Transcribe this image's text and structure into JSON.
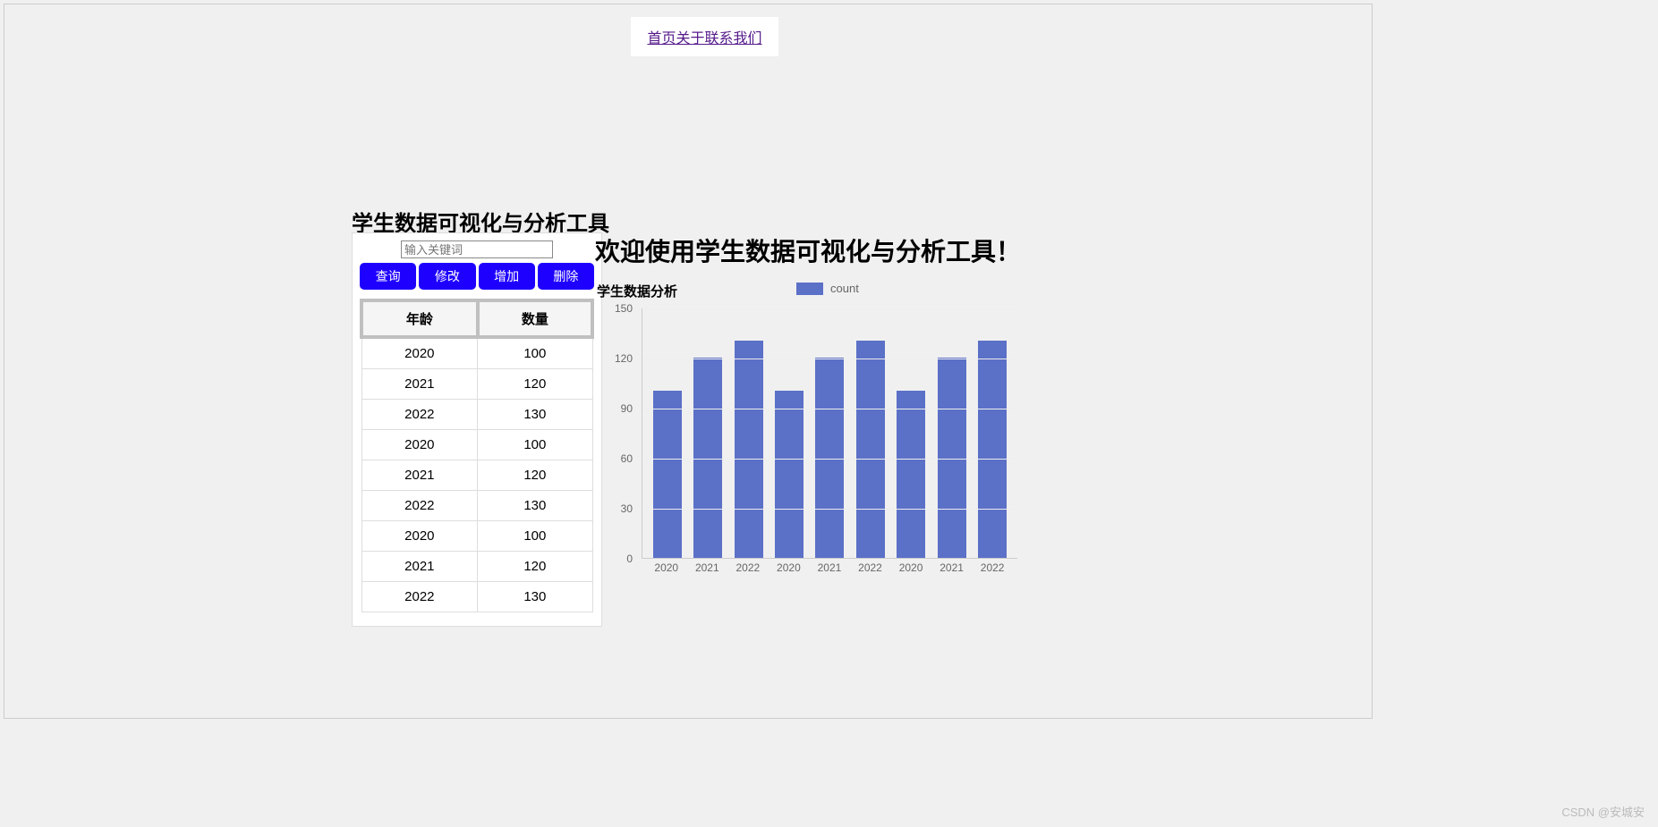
{
  "nav": {
    "links": [
      "首页",
      "关于",
      "联系我们"
    ]
  },
  "page_title": "学生数据可视化与分析工具",
  "search": {
    "placeholder": "输入关键词"
  },
  "buttons": {
    "query": "查询",
    "modify": "修改",
    "add": "增加",
    "delete": "删除"
  },
  "table": {
    "headers": {
      "age": "年龄",
      "count": "数量"
    },
    "rows": [
      {
        "age": "2020",
        "count": "100"
      },
      {
        "age": "2021",
        "count": "120"
      },
      {
        "age": "2022",
        "count": "130"
      },
      {
        "age": "2020",
        "count": "100"
      },
      {
        "age": "2021",
        "count": "120"
      },
      {
        "age": "2022",
        "count": "130"
      },
      {
        "age": "2020",
        "count": "100"
      },
      {
        "age": "2021",
        "count": "120"
      },
      {
        "age": "2022",
        "count": "130"
      }
    ]
  },
  "welcome_text": "欢迎使用学生数据可视化与分析工具！",
  "chart_section_title": "学生数据分析",
  "legend_label": "count",
  "chart_data": {
    "type": "bar",
    "title": "学生数据分析",
    "xlabel": "",
    "ylabel": "",
    "ylim": [
      0,
      150
    ],
    "y_ticks": [
      0,
      30,
      60,
      90,
      120,
      150
    ],
    "categories": [
      "2020",
      "2021",
      "2022",
      "2020",
      "2021",
      "2022",
      "2020",
      "2021",
      "2022"
    ],
    "series": [
      {
        "name": "count",
        "values": [
          100,
          120,
          130,
          100,
          120,
          130,
          100,
          120,
          130
        ]
      }
    ]
  },
  "watermark": "CSDN @安城安"
}
